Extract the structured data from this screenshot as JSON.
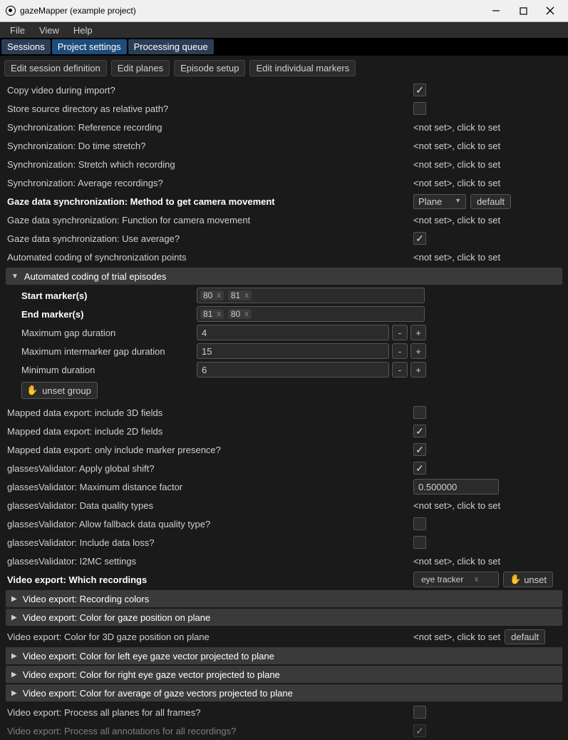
{
  "window": {
    "title": "gazeMapper (example project)"
  },
  "menu": {
    "file": "File",
    "view": "View",
    "help": "Help"
  },
  "tabs": {
    "sessions": "Sessions",
    "project_settings": "Project settings",
    "processing_queue": "Processing queue"
  },
  "subbtns": {
    "edit_session_def": "Edit session definition",
    "edit_planes": "Edit planes",
    "episode_setup": "Episode setup",
    "edit_individual_markers": "Edit individual markers"
  },
  "labels": {
    "copy_video": "Copy video during import?",
    "store_src": "Store source directory as relative path?",
    "sync_ref": "Synchronization: Reference recording",
    "sync_stretch": "Synchronization: Do time stretch?",
    "sync_stretch_which": "Synchronization: Stretch which recording",
    "sync_avg": "Synchronization: Average recordings?",
    "gaze_method": "Gaze data synchronization: Method to get camera movement",
    "gaze_func": "Gaze data synchronization: Function for camera movement",
    "gaze_use_avg": "Gaze data synchronization: Use average?",
    "auto_sync_points": "Automated coding of synchronization points",
    "auto_trial": "Automated coding of trial episodes",
    "start_markers": "Start marker(s)",
    "end_markers": "End marker(s)",
    "max_gap": "Maximum gap duration",
    "max_intermarker": "Maximum intermarker gap duration",
    "min_duration": "Minimum duration",
    "unset_group": "unset group",
    "export_3d": "Mapped data export: include 3D fields",
    "export_2d": "Mapped data export: include 2D fields",
    "export_marker_presence": "Mapped data export: only include marker presence?",
    "gv_global_shift": "glassesValidator: Apply global shift?",
    "gv_max_dist": "glassesValidator: Maximum distance factor",
    "gv_dq_types": "glassesValidator: Data quality types",
    "gv_fallback": "glassesValidator: Allow fallback data quality type?",
    "gv_data_loss": "glassesValidator: Include data loss?",
    "gv_i2mc": "glassesValidator: I2MC settings",
    "ve_which": "Video export: Which recordings",
    "ve_colors": "Video export: Recording colors",
    "ve_gaze_plane": "Video export: Color for gaze position on plane",
    "ve_3d_gaze": "Video export: Color for 3D gaze position on plane",
    "ve_left_eye": "Video export: Color for left eye gaze vector projected to plane",
    "ve_right_eye": "Video export: Color for right eye gaze vector projected to plane",
    "ve_avg_eye": "Video export: Color for average of gaze vectors projected to plane",
    "ve_all_planes": "Video export: Process all planes for all frames?",
    "ve_all_annotations": "Video export: Process all annotations for all recordings?"
  },
  "values": {
    "notset": "<not set>, click to set",
    "plane": "Plane",
    "default": "default",
    "start_tags": [
      "80",
      "81"
    ],
    "end_tags": [
      "81",
      "80"
    ],
    "max_gap": "4",
    "max_intermarker": "15",
    "min_duration": "6",
    "max_dist": "0.500000",
    "eye_tracker": "eye tracker",
    "unset": "unset"
  }
}
